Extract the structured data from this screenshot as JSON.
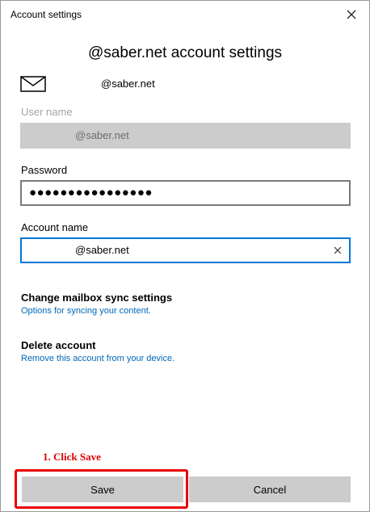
{
  "window": {
    "title": "Account settings"
  },
  "heading": "@saber.net account settings",
  "account": {
    "email": "@saber.net",
    "icon": "mail-icon"
  },
  "fields": {
    "user_name_label": "User name",
    "user_name_value": "@saber.net",
    "password_label": "Password",
    "password_value": "●●●●●●●●●●●●●●●●",
    "account_name_label": "Account name",
    "account_name_value": "@saber.net"
  },
  "links": {
    "sync_title": "Change mailbox sync settings",
    "sync_sub": "Options for syncing your content.",
    "delete_title": "Delete account",
    "delete_sub": "Remove this account from your device."
  },
  "annotation": "1. Click Save",
  "buttons": {
    "save": "Save",
    "cancel": "Cancel"
  },
  "colors": {
    "accent": "#0078d7",
    "link": "#0067b8",
    "annotation": "#e00000",
    "button_bg": "#cccccc"
  }
}
